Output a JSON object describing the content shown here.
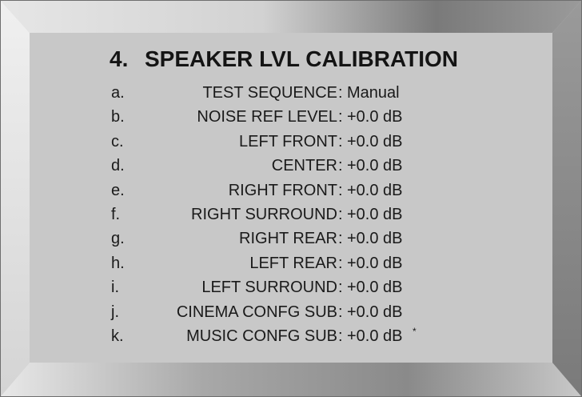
{
  "menu": {
    "number": "4.",
    "title": "SPEAKER LVL CALIBRATION",
    "items": [
      {
        "letter": "a.",
        "label": "TEST SEQUENCE",
        "value": "Manual",
        "note": ""
      },
      {
        "letter": "b.",
        "label": "NOISE REF LEVEL",
        "value": "+0.0 dB",
        "note": ""
      },
      {
        "letter": "c.",
        "label": "LEFT FRONT",
        "value": "+0.0 dB",
        "note": ""
      },
      {
        "letter": "d.",
        "label": "CENTER",
        "value": "+0.0 dB",
        "note": ""
      },
      {
        "letter": "e.",
        "label": "RIGHT FRONT",
        "value": "+0.0 dB",
        "note": ""
      },
      {
        "letter": "f.",
        "label": "RIGHT SURROUND",
        "value": "+0.0 dB",
        "note": ""
      },
      {
        "letter": "g.",
        "label": "RIGHT REAR",
        "value": "+0.0 dB",
        "note": ""
      },
      {
        "letter": "h.",
        "label": "LEFT REAR",
        "value": "+0.0 dB",
        "note": ""
      },
      {
        "letter": "i.",
        "label": "LEFT SURROUND",
        "value": "+0.0 dB",
        "note": ""
      },
      {
        "letter": "j.",
        "label": "CINEMA CONFG SUB",
        "value": "+0.0 dB",
        "note": ""
      },
      {
        "letter": "k.",
        "label": "MUSIC CONFG SUB",
        "value": "+0.0 dB",
        "note": "*"
      }
    ],
    "separator": ":"
  },
  "colors": {
    "panel": "#c8c8c8",
    "text": "#1a1a1a"
  }
}
